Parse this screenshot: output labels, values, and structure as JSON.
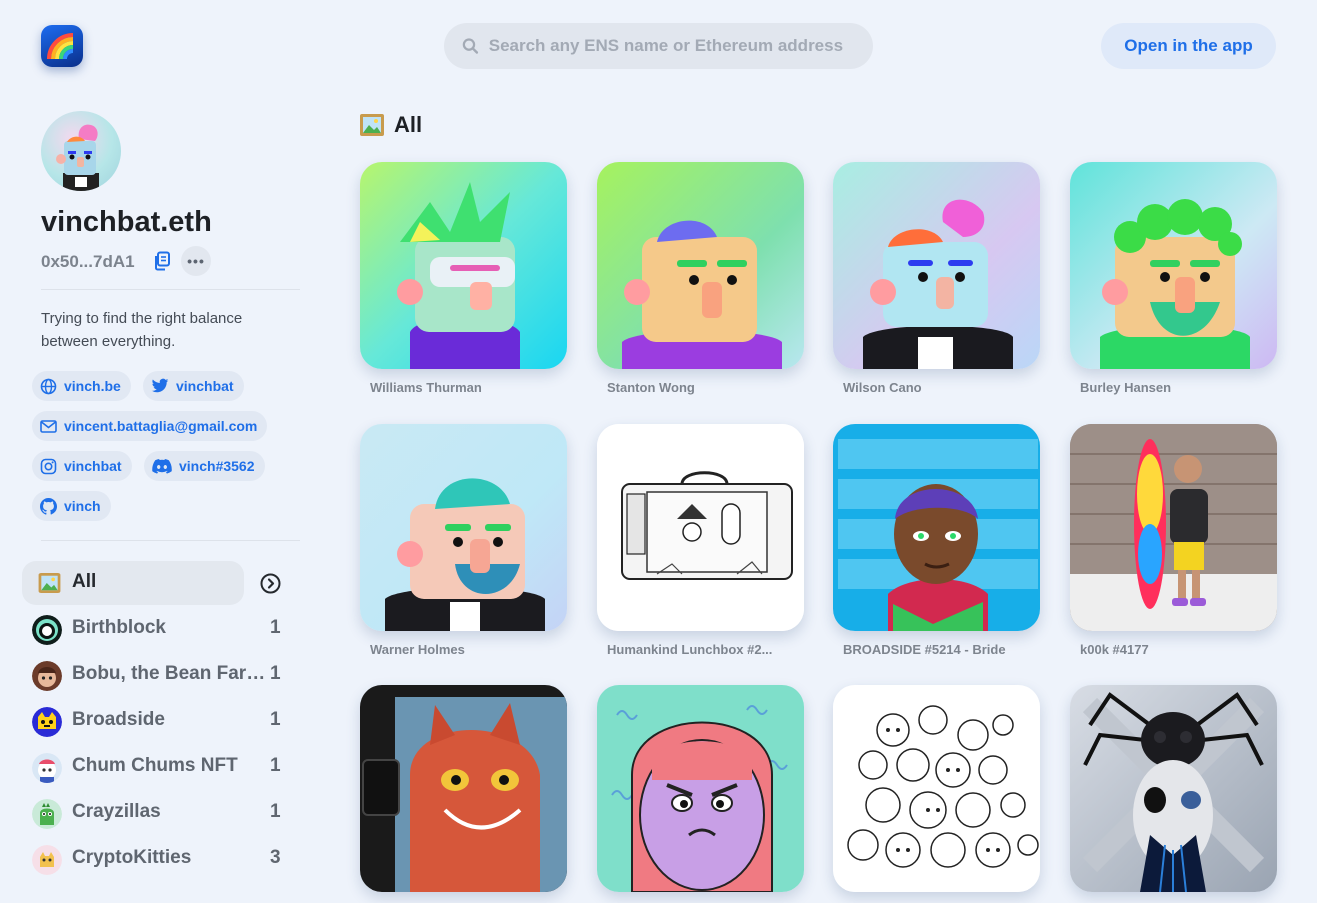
{
  "header": {
    "search_placeholder": "Search any ENS name or Ethereum address",
    "open_app_label": "Open in the app"
  },
  "profile": {
    "name": "vinchbat.eth",
    "address": "0x50...7dA1",
    "bio": "Trying to find the right balance between everything.",
    "links": {
      "website": "vinch.be",
      "twitter": "vinchbat",
      "email": "vincent.battaglia@gmail.com",
      "instagram": "vinchbat",
      "discord": "vinch#3562",
      "github": "vinch"
    }
  },
  "sidebar": {
    "items": [
      {
        "label": "All",
        "count": ""
      },
      {
        "label": "Birthblock",
        "count": "1"
      },
      {
        "label": "Bobu, the Bean Farmer",
        "count": "1"
      },
      {
        "label": "Broadside",
        "count": "1"
      },
      {
        "label": "Chum Chums NFT",
        "count": "1"
      },
      {
        "label": "Crayzillas",
        "count": "1"
      },
      {
        "label": "CryptoKitties",
        "count": "3"
      }
    ]
  },
  "main": {
    "section_title": "All",
    "cards": [
      {
        "title": "Williams Thurman"
      },
      {
        "title": "Stanton Wong"
      },
      {
        "title": "Wilson Cano"
      },
      {
        "title": "Burley Hansen"
      },
      {
        "title": "Warner Holmes"
      },
      {
        "title": "Humankind Lunchbox #2..."
      },
      {
        "title": "BROADSIDE #5214 - Bride"
      },
      {
        "title": "k00k #4177"
      },
      {
        "title": ""
      },
      {
        "title": ""
      },
      {
        "title": ""
      },
      {
        "title": ""
      }
    ]
  },
  "colors": {
    "accent": "#1f6fe8",
    "background": "#eef3fb"
  }
}
